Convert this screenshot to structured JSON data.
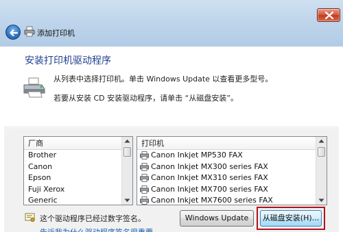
{
  "window": {
    "title": "添加打印机"
  },
  "page": {
    "heading": "安装打印机驱动程序",
    "instruction_1": "从列表中选择打印机。单击 Windows Update 以查看更多型号。",
    "instruction_2": "若要从安装 CD 安装驱动程序，请单击 “从磁盘安装”。"
  },
  "manufacturers": {
    "header": "厂商",
    "items": [
      "Brother",
      "Canon",
      "Epson",
      "Fuji Xerox",
      "Generic"
    ],
    "selected": "Canon"
  },
  "printers": {
    "header": "打印机",
    "items": [
      "Canon Inkjet MP530 FAX",
      "Canon Inkjet MX300 series FAX",
      "Canon Inkjet MX310 series FAX",
      "Canon Inkjet MX700 series FAX",
      "Canon Inkjet MX7600 series FAX"
    ]
  },
  "footer": {
    "signature_text": "这个驱动程序已经过数字签名。",
    "signature_link": "告诉我为什么驱动程序签名很重要",
    "windows_update_label": "Windows Update",
    "have_disk_label": "从磁盘安装(H)..."
  },
  "colors": {
    "heading": "#1f3f8f",
    "link": "#1a5fb4",
    "highlight_outline": "#b0121b"
  }
}
